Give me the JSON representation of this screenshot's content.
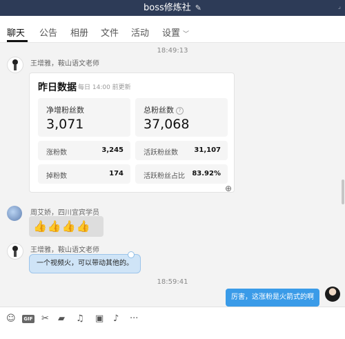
{
  "window": {
    "title": "boss修炼社",
    "edit_icon": "pencil-icon"
  },
  "tabs": [
    {
      "label": "聊天",
      "active": true
    },
    {
      "label": "公告"
    },
    {
      "label": "相册"
    },
    {
      "label": "文件"
    },
    {
      "label": "活动"
    },
    {
      "label": "设置"
    }
  ],
  "messages": {
    "time1": "18:49:13",
    "msg1": {
      "sender": "王增雅，鞍山语文老师",
      "card": {
        "title": "昨日数据",
        "subtitle": "每日 14:00 前更新",
        "net_fans_label": "净增粉丝数",
        "net_fans_value": "3,071",
        "total_fans_label": "总粉丝数",
        "total_fans_value": "37,068",
        "rows": [
          {
            "label": "涨粉数",
            "value": "3,245"
          },
          {
            "label": "活跃粉丝数",
            "value": "31,107"
          },
          {
            "label": "掉粉数",
            "value": "174"
          },
          {
            "label": "活跃粉丝占比",
            "value": "83.92%"
          }
        ]
      }
    },
    "msg2": {
      "sender": "周艾娇，四川宜宾学员",
      "content": "👍👍👍👍"
    },
    "msg3": {
      "sender": "王增雅，鞍山语文老师",
      "content": "一个视频火，可以带动其他的。"
    },
    "time2": "18:59:41",
    "msg4": {
      "content": "厉害，这涨粉是火箭式的啊"
    }
  },
  "toolbar": {
    "icons": [
      "emoji-icon",
      "gif-icon",
      "scissors-icon",
      "folder-icon",
      "music-icon",
      "image-icon",
      "bell-icon",
      "more-icon"
    ],
    "gif_label": "GIF"
  },
  "colors": {
    "titlebar": "#2d3b57",
    "accent": "#3a9be8",
    "left_bubble": "#cfe4f7"
  }
}
